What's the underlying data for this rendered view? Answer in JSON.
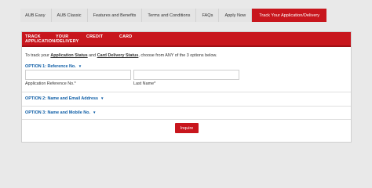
{
  "tabs": [
    {
      "label": "AUB Easy",
      "active": false
    },
    {
      "label": "AUB Classic",
      "active": false
    },
    {
      "label": "Features and Benefits",
      "active": false
    },
    {
      "label": "Terms and Conditions",
      "active": false
    },
    {
      "label": "FAQs",
      "active": false
    },
    {
      "label": "Apply Now",
      "active": false
    },
    {
      "label": "Track Your Application/Delivery",
      "active": true
    }
  ],
  "panel": {
    "header": {
      "track": "TRACK",
      "appdel": "APPLICATION/DELIVERY",
      "your": "YOUR",
      "credit": "CREDIT",
      "card": "CARD"
    },
    "intro": {
      "prefix": "To track your ",
      "app_status": "Application Status",
      "and": " and ",
      "card_status": "Card Delivery Status",
      "suffix": ", choose from ANY of the 3 options below."
    },
    "option1": {
      "title": "OPTION 1: Reference No."
    },
    "option2": {
      "title": "OPTION 2: Name and Email Address"
    },
    "option3": {
      "title": "OPTION 3: Name and Mobile No."
    },
    "fields": {
      "reference": {
        "label": "Application Reference No.*",
        "value": ""
      },
      "last_name": {
        "label": "Last Name*",
        "value": ""
      }
    },
    "submit_label": "Inquire"
  },
  "colors": {
    "brand_red": "#c8161d",
    "link_blue": "#0d5da6",
    "background": "#e9e9e9"
  }
}
